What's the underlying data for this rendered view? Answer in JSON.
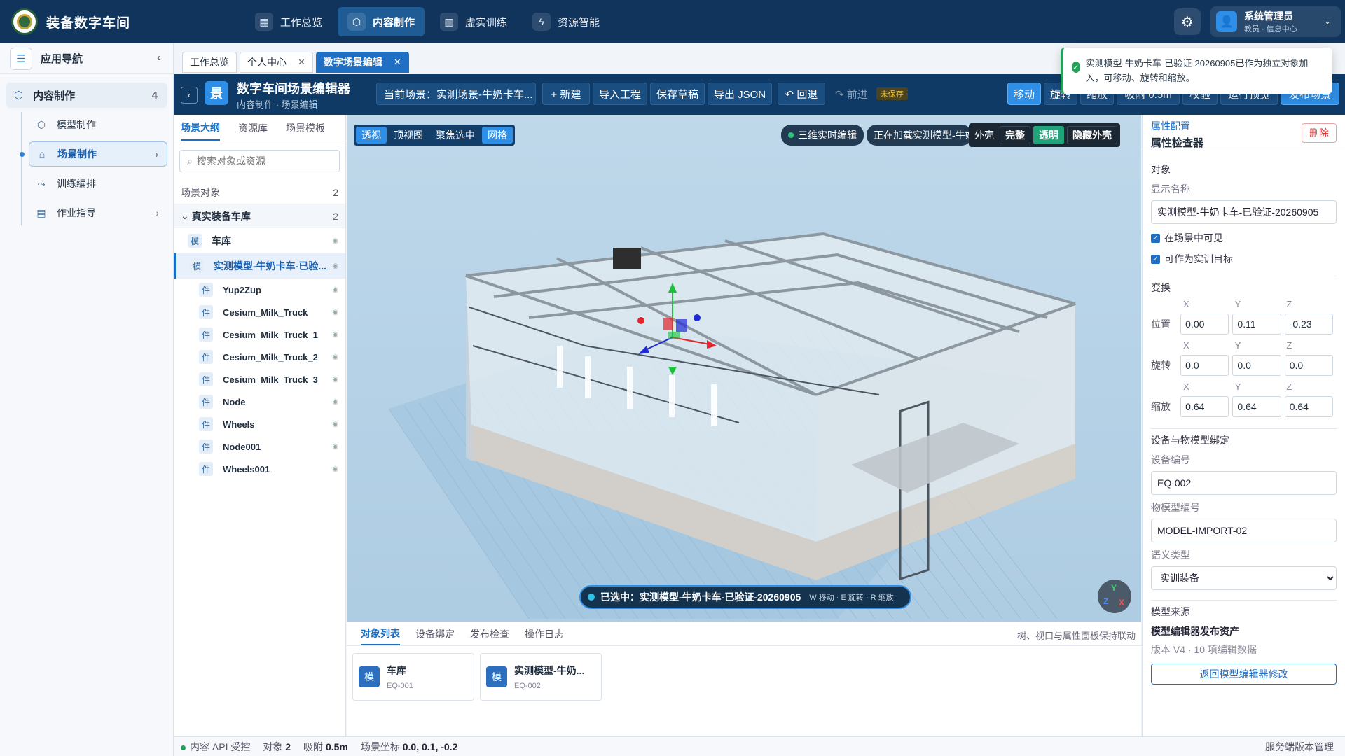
{
  "app": {
    "title": "装备数字车间"
  },
  "topnav": [
    {
      "label": "工作总览",
      "icon": "grid-icon"
    },
    {
      "label": "内容制作",
      "icon": "cube-icon"
    },
    {
      "label": "虚实训练",
      "icon": "book-icon"
    },
    {
      "label": "资源智能",
      "icon": "plug-icon"
    }
  ],
  "user": {
    "name": "系统管理员",
    "role": "教员 · 信息中心"
  },
  "sidebar": {
    "title": "应用导航",
    "group": {
      "label": "内容制作",
      "count": "4"
    },
    "items": [
      {
        "label": "模型制作",
        "icon": "cube-icon"
      },
      {
        "label": "场景制作",
        "icon": "home-icon"
      },
      {
        "label": "训练编排",
        "icon": "route-icon"
      },
      {
        "label": "作业指导",
        "icon": "document-icon"
      }
    ]
  },
  "tabs": [
    {
      "label": "工作总览"
    },
    {
      "label": "个人中心"
    },
    {
      "label": "数字场景编辑"
    }
  ],
  "toast": {
    "message": "实测模型-牛奶卡车-已验证-20260905已作为独立对象加入，可移动、旋转和缩放。"
  },
  "editor": {
    "badge": "景",
    "title": "数字车间场景编辑器",
    "subtitle": "内容制作 · 场景编辑",
    "current_scene": "当前场景：实测场景-牛奶卡车...",
    "new": "+ 新建",
    "import": "导入工程",
    "save_draft": "保存草稿",
    "export_json": "导出 JSON",
    "undo": "↶ 回退",
    "redo": "↷ 前进",
    "unsaved": "未保存",
    "move": "移动",
    "rotate": "旋转",
    "scale": "缩放",
    "snap": "吸附 0.5m",
    "check": "校验",
    "run_preview": "运行预览",
    "publish": "发布场景"
  },
  "left": {
    "tabs": [
      "场景大纲",
      "资源库",
      "场景模板"
    ],
    "search_placeholder": "搜索对象或资源",
    "section": {
      "label": "场景对象",
      "count": "2"
    },
    "group": {
      "label": "真实装备车库",
      "count": "2"
    },
    "objects": [
      {
        "tag": "模",
        "label": "车库"
      },
      {
        "tag": "模",
        "label": "实测模型-牛奶卡车-已验..."
      }
    ],
    "children": [
      {
        "tag": "件",
        "label": "Yup2Zup"
      },
      {
        "tag": "件",
        "label": "Cesium_Milk_Truck"
      },
      {
        "tag": "件",
        "label": "Cesium_Milk_Truck_1"
      },
      {
        "tag": "件",
        "label": "Cesium_Milk_Truck_2"
      },
      {
        "tag": "件",
        "label": "Cesium_Milk_Truck_3"
      },
      {
        "tag": "件",
        "label": "Node"
      },
      {
        "tag": "件",
        "label": "Wheels"
      },
      {
        "tag": "件",
        "label": "Node001"
      },
      {
        "tag": "件",
        "label": "Wheels001"
      }
    ]
  },
  "viewport": {
    "modes": [
      "透视",
      "顶视图",
      "聚焦选中",
      "网格"
    ],
    "live": "三维实时编辑",
    "loading": "正在加载实测模型-牛奶卡车",
    "shell": {
      "label": "外壳",
      "full": "完整",
      "transparent": "透明",
      "hide": "隐藏外壳"
    },
    "selected": "已选中：实测模型-牛奶卡车-已验证-20260905",
    "hint": "W 移动 · E 旋转 · R 缩放",
    "axes": {
      "y": "Y",
      "z": "Z",
      "x": "X"
    }
  },
  "bottom": {
    "tabs": [
      "对象列表",
      "设备绑定",
      "发布检查",
      "操作日志"
    ],
    "note": "树、视口与属性面板保持联动",
    "cards": [
      {
        "tag": "模",
        "name": "车库",
        "code": "EQ-001"
      },
      {
        "tag": "模",
        "name": "实测模型-牛奶...",
        "code": "EQ-002"
      }
    ]
  },
  "props": {
    "header_sub": "属性配置",
    "header": "属性检查器",
    "delete": "删除",
    "object_section": "对象",
    "display_name_label": "显示名称",
    "display_name": "实测模型-牛奶卡车-已验证-20260905",
    "visible": "在场景中可见",
    "training_target": "可作为实训目标",
    "transform_section": "变换",
    "xyz": [
      "X",
      "Y",
      "Z"
    ],
    "position_label": "位置",
    "position": [
      "0.00",
      "0.11",
      "-0.23"
    ],
    "rotation_label": "旋转",
    "rotation": [
      "0.0",
      "0.0",
      "0.0"
    ],
    "scale_label": "缩放",
    "scale": [
      "0.64",
      "0.64",
      "0.64"
    ],
    "binding_section": "设备与物模型绑定",
    "device_code_label": "设备编号",
    "device_code": "EQ-002",
    "model_code_label": "物模型编号",
    "model_code": "MODEL-IMPORT-02",
    "semantic_label": "语义类型",
    "semantic": "实训装备",
    "source_section": "模型来源",
    "source_title": "模型编辑器发布资产",
    "source_meta": "版本 V4 · 10 项编辑数据",
    "back_to_editor": "返回模型编辑器修改"
  },
  "status": {
    "api": "内容 API 受控",
    "objects_label": "对象",
    "objects": "2",
    "snap_label": "吸附",
    "snap": "0.5m",
    "coords_label": "场景坐标",
    "coords": "0.0, 0.1, -0.2",
    "right": "服务端版本管理"
  }
}
